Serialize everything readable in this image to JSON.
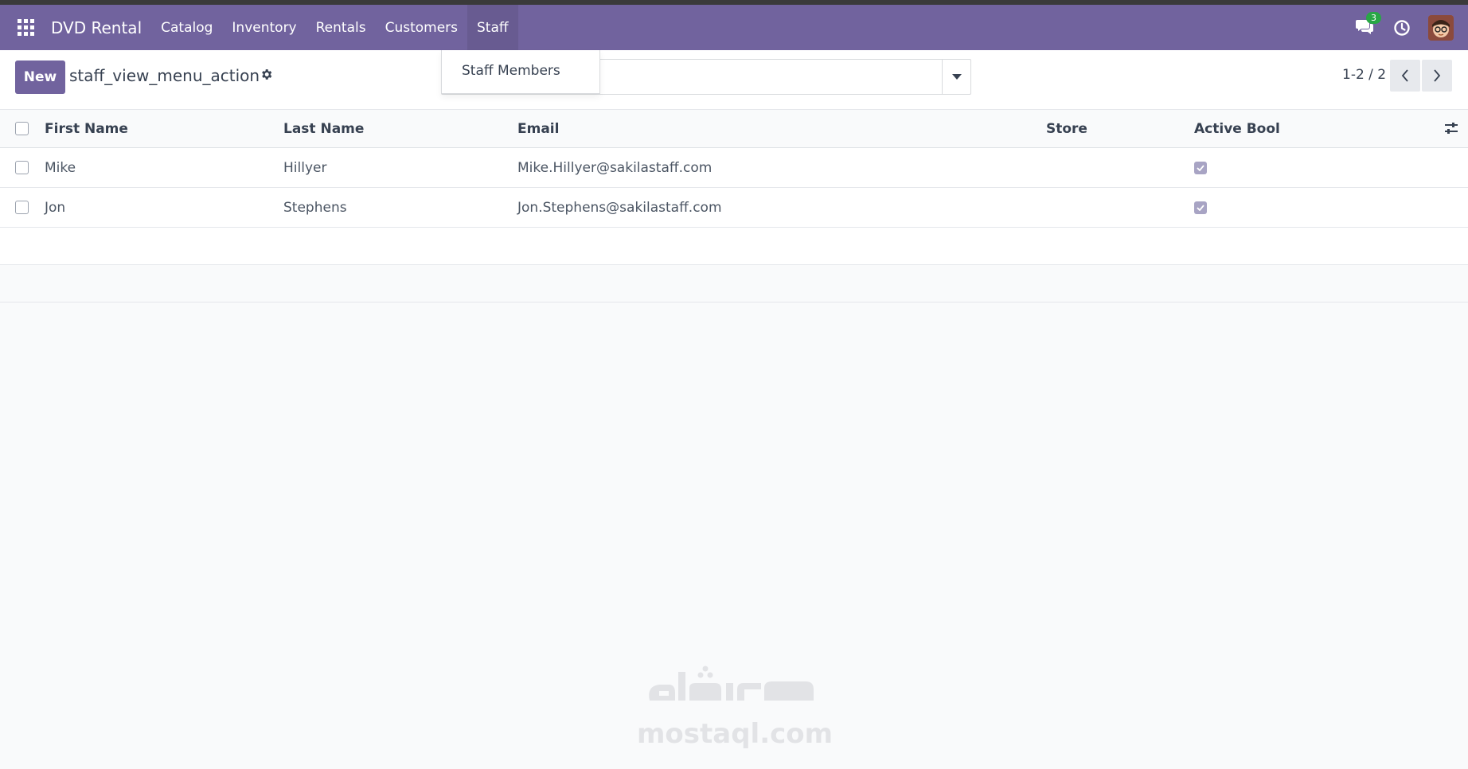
{
  "navbar": {
    "brand": "DVD Rental",
    "menu": [
      "Catalog",
      "Inventory",
      "Rentals",
      "Customers",
      "Staff"
    ],
    "active_menu": "Staff",
    "messages_badge": "3",
    "bg_color": "#71639e"
  },
  "control": {
    "new_button": "New",
    "title": "staff_view_menu_action",
    "pager": "1-2 / 2"
  },
  "dropdown": {
    "items": [
      "Staff Members"
    ]
  },
  "table": {
    "columns": [
      "First Name",
      "Last Name",
      "Email",
      "Store",
      "Active Bool"
    ],
    "rows": [
      {
        "first": "Mike",
        "last": "Hillyer",
        "email": "Mike.Hillyer@sakilastaff.com",
        "store": "",
        "active": true
      },
      {
        "first": "Jon",
        "last": "Stephens",
        "email": "Jon.Stephens@sakilastaff.com",
        "store": "",
        "active": true
      }
    ]
  },
  "watermark": {
    "text": "mostaql.com"
  }
}
